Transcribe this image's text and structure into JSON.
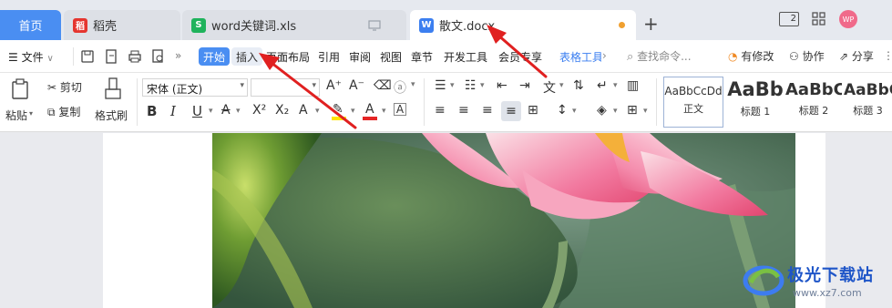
{
  "tabs": {
    "home": "首页",
    "daoke": "稻壳",
    "xls": "word关键词.xls",
    "docx": "散文.docx"
  },
  "titlebar": {
    "avatar": "WP",
    "window_num": "2"
  },
  "menu": {
    "file": "文件",
    "items": [
      "开始",
      "插入",
      "页面布局",
      "引用",
      "审阅",
      "视图",
      "章节",
      "开发工具",
      "会员专享",
      "表格工具"
    ],
    "search_placeholder": "查找命令...",
    "modified": "有修改",
    "collab": "协作",
    "share": "分享"
  },
  "ribbon": {
    "paste": "粘贴",
    "cut": "剪切",
    "copy": "复制",
    "format_painter": "格式刷",
    "font_name": "宋体 (正文)",
    "styles": [
      {
        "sample": "AaBbCcDd",
        "name": "正文"
      },
      {
        "sample": "AaBb",
        "name": "标题 1"
      },
      {
        "sample": "AaBbC",
        "name": "标题 2"
      },
      {
        "sample": "AaBbC",
        "name": "标题 3"
      }
    ]
  },
  "watermark": {
    "title": "极光下载站",
    "url": "www.xz7.com"
  },
  "colors": {
    "accent": "#4a8ef2",
    "highlight": "#ffe500",
    "font_color": "#e52626",
    "arrow": "#e02020"
  }
}
